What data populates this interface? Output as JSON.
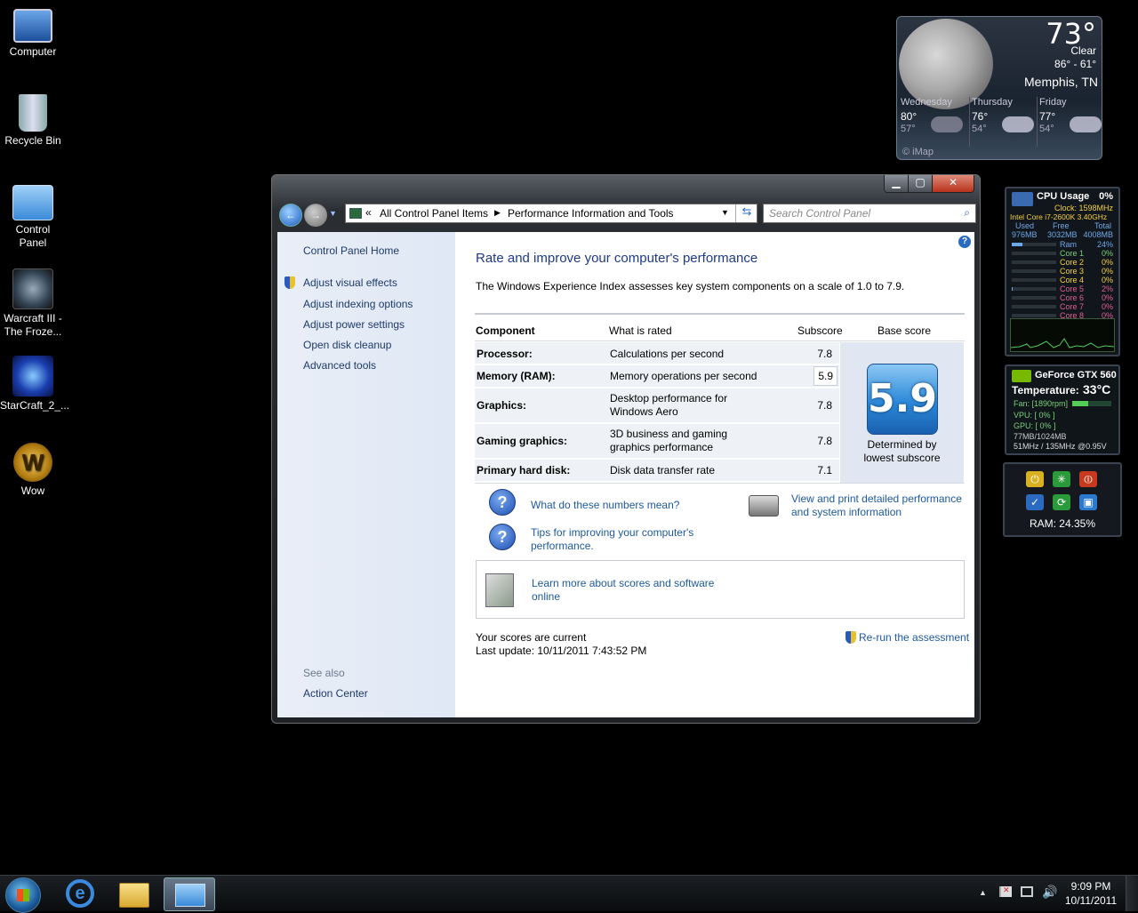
{
  "desktop": {
    "icons": [
      {
        "label_1": "Computer",
        "label_2": ""
      },
      {
        "label_1": "Recycle Bin",
        "label_2": ""
      },
      {
        "label_1": "Control",
        "label_2": "Panel"
      },
      {
        "label_1": "Warcraft III -",
        "label_2": "The Froze..."
      },
      {
        "label_1": "StarCraft_2_...",
        "label_2": ""
      },
      {
        "label_1": "Wow",
        "label_2": ""
      }
    ]
  },
  "weather": {
    "temp": "73°",
    "condition": "Clear",
    "range": "86° - 61°",
    "city": "Memphis, TN",
    "forecast": [
      {
        "day": "Wednesday",
        "hi": "80°",
        "lo": "57°"
      },
      {
        "day": "Thursday",
        "hi": "76°",
        "lo": "54°"
      },
      {
        "day": "Friday",
        "hi": "77°",
        "lo": "54°"
      }
    ],
    "source": "© iMap"
  },
  "cpu_gadget": {
    "title": "CPU Usage",
    "percent": "0%",
    "clock": "Clock: 1598MHz",
    "model": "Intel Core i7-2600K 3.40GHz",
    "mem_headers": [
      "Used",
      "Free",
      "Total"
    ],
    "mem_values": [
      "976MB",
      "3032MB",
      "4008MB"
    ],
    "rows": [
      {
        "name": "Ram",
        "value": "24%"
      },
      {
        "name": "Core 1",
        "value": "0%"
      },
      {
        "name": "Core 2",
        "value": "0%"
      },
      {
        "name": "Core 3",
        "value": "0%"
      },
      {
        "name": "Core 4",
        "value": "0%"
      },
      {
        "name": "Core 5",
        "value": "2%"
      },
      {
        "name": "Core 6",
        "value": "0%"
      },
      {
        "name": "Core 7",
        "value": "0%"
      },
      {
        "name": "Core 8",
        "value": "0%"
      }
    ]
  },
  "gpu_gadget": {
    "name": "GeForce GTX 560",
    "temperature_label": "Temperature:",
    "temperature": "33°C",
    "fan": "Fan: [1890rpm]",
    "vpu": "VPU: [ 0% ]",
    "gpu": "GPU: [ 0% ]",
    "memory": "77MB/1024MB",
    "clocks": "51MHz / 135MHz @0.95V"
  },
  "shutdown_gadget": {
    "ram": "RAM: 24.35%"
  },
  "window": {
    "breadcrumb_prefix": "«",
    "breadcrumb": [
      "All Control Panel Items",
      "Performance Information and Tools"
    ],
    "search_placeholder": "Search Control Panel",
    "left_nav": {
      "home": "Control Panel Home",
      "links": [
        "Adjust visual effects",
        "Adjust indexing options",
        "Adjust power settings",
        "Open disk cleanup",
        "Advanced tools"
      ],
      "see_also": "See also",
      "action_center": "Action Center"
    },
    "heading": "Rate and improve your computer's performance",
    "description": "The Windows Experience Index assesses key system components on a scale of 1.0 to 7.9.",
    "table": {
      "headers": [
        "Component",
        "What is rated",
        "Subscore",
        "Base score"
      ],
      "rows": [
        {
          "component": "Processor:",
          "rated_1": "Calculations per second",
          "rated_2": "",
          "subscore": "7.8"
        },
        {
          "component": "Memory (RAM):",
          "rated_1": "Memory operations per second",
          "rated_2": "",
          "subscore": "5.9"
        },
        {
          "component": "Graphics:",
          "rated_1": "Desktop performance for",
          "rated_2": "Windows Aero",
          "subscore": "7.8"
        },
        {
          "component": "Gaming graphics:",
          "rated_1": "3D business and gaming",
          "rated_2": "graphics performance",
          "subscore": "7.8"
        },
        {
          "component": "Primary hard disk:",
          "rated_1": "Disk data transfer rate",
          "rated_2": "",
          "subscore": "7.1"
        }
      ],
      "base_score": "5.9",
      "base_caption_1": "Determined by",
      "base_caption_2": "lowest subscore"
    },
    "links": {
      "numbers_meaning": "What do these numbers mean?",
      "tips_1": "Tips for improving your computer's",
      "tips_2": "performance.",
      "print_1": "View and print detailed performance",
      "print_2": "and system information",
      "learn_1": "Learn more about scores and software",
      "learn_2": "online"
    },
    "status": "Your scores are current",
    "last_update": "Last update: 10/11/2011 7:43:52 PM",
    "rerun": "Re-run the assessment"
  },
  "taskbar": {
    "time": "9:09 PM",
    "date": "10/11/2011"
  },
  "colors": {
    "link": "#1e5aa0",
    "accent": "#2b88d8"
  }
}
